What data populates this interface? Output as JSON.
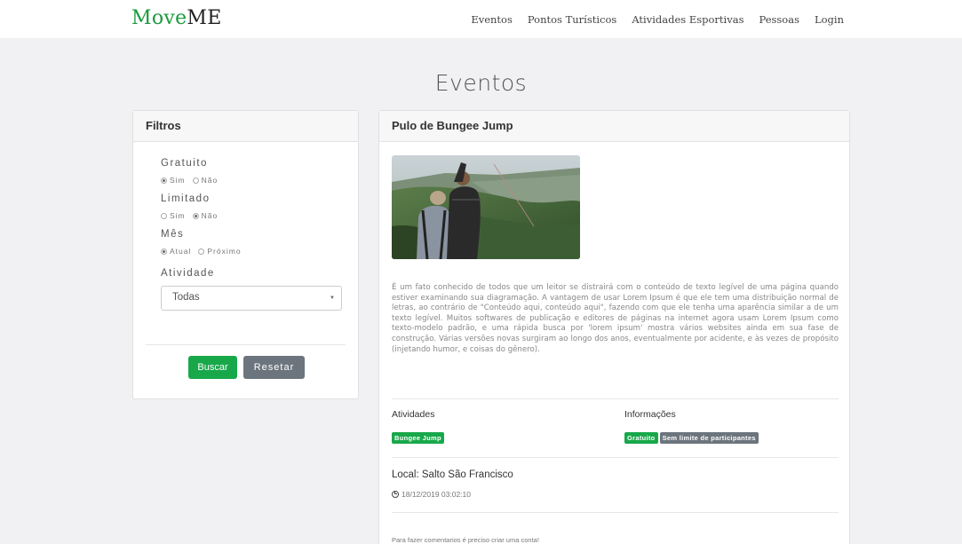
{
  "brand": {
    "part1": "Move",
    "part2": "ME"
  },
  "nav": [
    "Eventos",
    "Pontos Turísticos",
    "Atividades Esportivas",
    "Pessoas",
    "Login"
  ],
  "page_title": "Eventos",
  "filters": {
    "title": "Filtros",
    "groups": [
      {
        "label": "Gratuito",
        "options": [
          "Sim",
          "Não"
        ],
        "selected": "Sim"
      },
      {
        "label": "Limitado",
        "options": [
          "Sim",
          "Não"
        ],
        "selected": "Não"
      },
      {
        "label": "Mês",
        "options": [
          "Atual",
          "Próximo"
        ],
        "selected": "Atual"
      }
    ],
    "atividade_label": "Atividade",
    "atividade_value": "Todas",
    "buscar": "Buscar",
    "resetar": "Resetar"
  },
  "event": {
    "title": "Pulo de Bungee Jump",
    "description": "É um fato conhecido de todos que um leitor se distrairá com o conteúdo de texto legível de uma página quando estiver examinando sua diagramação. A vantagem de usar Lorem Ipsum é que ele tem uma distribuição normal de letras, ao contrário de \"Conteúdo aqui, conteúdo aqui\", fazendo com que ele tenha uma aparência similar a de um texto legível. Muitos softwares de publicação e editores de páginas na internet agora usam Lorem Ipsum como texto-modelo padrão, e uma rápida busca por 'lorem ipsum' mostra vários websites ainda em sua fase de construção. Várias versões novas surgiram ao longo dos anos, eventualmente por acidente, e às vezes de propósito (injetando humor, e coisas do gênero).",
    "atividades_title": "Atividades",
    "atividades": [
      "Bungee Jump"
    ],
    "informacoes_title": "Informações",
    "informacoes": [
      "Gratuito",
      "Sem limite de participantes"
    ],
    "local": "Local: Salto São Francisco",
    "datetime": "18/12/2019 03:02:10",
    "comment_note": "Para fazer comentarios é preciso criar uma conta!"
  },
  "colors": {
    "accent": "#18a84a",
    "secondary": "#6c757d",
    "background": "#f1f1f3"
  }
}
